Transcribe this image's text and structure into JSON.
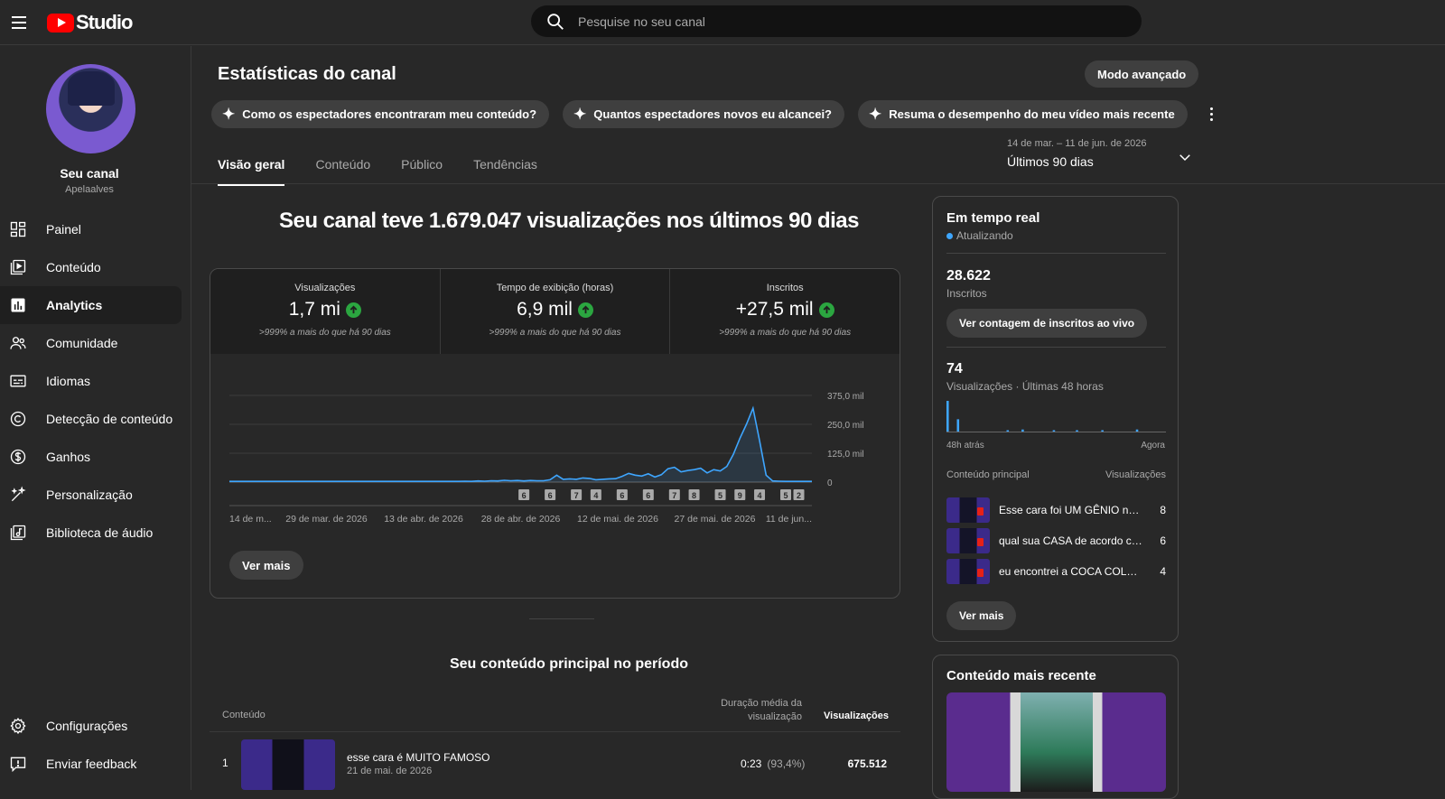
{
  "app": {
    "logo_text": "Studio"
  },
  "search": {
    "placeholder": "Pesquise no seu canal"
  },
  "sidebar": {
    "channel_name": "Seu canal",
    "channel_handle": "Apelaalves",
    "items": [
      {
        "label": "Painel",
        "icon": "dashboard-icon"
      },
      {
        "label": "Conteúdo",
        "icon": "content-icon"
      },
      {
        "label": "Analytics",
        "icon": "analytics-icon",
        "active": true
      },
      {
        "label": "Comunidade",
        "icon": "community-icon"
      },
      {
        "label": "Idiomas",
        "icon": "subtitles-icon"
      },
      {
        "label": "Detecção de conteúdo",
        "icon": "copyright-icon"
      },
      {
        "label": "Ganhos",
        "icon": "dollar-icon"
      },
      {
        "label": "Personalização",
        "icon": "magic-wand-icon"
      },
      {
        "label": "Biblioteca de áudio",
        "icon": "audio-library-icon"
      }
    ],
    "bottom_items": [
      {
        "label": "Configurações",
        "icon": "gear-icon"
      },
      {
        "label": "Enviar feedback",
        "icon": "feedback-icon"
      }
    ]
  },
  "header": {
    "title": "Estatísticas do canal",
    "advanced_mode": "Modo avançado",
    "chips": [
      "Como os espectadores encontraram meu conteúdo?",
      "Quantos espectadores novos eu alcancei?",
      "Resuma o desempenho do meu vídeo mais recente"
    ],
    "tabs": [
      "Visão geral",
      "Conteúdo",
      "Público",
      "Tendências"
    ],
    "date_range": "14 de mar. – 11 de jun. de 2026",
    "date_label": "Últimos 90 dias"
  },
  "overview": {
    "headline": "Seu canal teve 1.679.047 visualizações nos últimos 90 dias",
    "kpis": [
      {
        "label": "Visualizações",
        "value": "1,7 mi",
        "note": ">999% a mais do que há 90 dias"
      },
      {
        "label": "Tempo de exibição (horas)",
        "value": "6,9 mil",
        "note": ">999% a mais do que há 90 dias"
      },
      {
        "label": "Inscritos",
        "value": "+27,5 mil",
        "note": ">999% a mais do que há 90 dias"
      }
    ],
    "see_more": "Ver mais"
  },
  "chart_data": {
    "type": "area",
    "x_tick_labels": [
      "14 de m...",
      "29 de mar. de 2026",
      "13 de abr. de 2026",
      "28 de abr. de 2026",
      "12 de mai. de 2026",
      "27 de mai. de 2026",
      "11 de jun..."
    ],
    "y_tick_labels": [
      "375,0 mil",
      "250,0 mil",
      "125,0 mil",
      "0"
    ],
    "ylim": [
      0,
      375000
    ],
    "grid": true,
    "series": [
      {
        "values": [
          3000,
          3000,
          3000,
          3000,
          3000,
          3000,
          3000,
          3000,
          3000,
          3000,
          3000,
          3000,
          3000,
          3000,
          3000,
          3000,
          3000,
          3000,
          3000,
          3000,
          3000,
          3000,
          3000,
          3000,
          3000,
          3000,
          3000,
          3000,
          3000,
          3000,
          3000,
          3000,
          3000,
          3000,
          3000,
          3000,
          4000,
          3000,
          5000,
          4000,
          6000,
          5000,
          8000,
          6000,
          7000,
          5000,
          7000,
          6000,
          6000,
          10000,
          30000,
          12000,
          14000,
          12000,
          18000,
          16000,
          10000,
          12000,
          14000,
          15000,
          25000,
          38000,
          30000,
          26000,
          36000,
          22000,
          32000,
          58000,
          64000,
          44000,
          50000,
          54000,
          60000,
          40000,
          54000,
          48000,
          68000,
          120000,
          190000,
          250000,
          320000,
          180000,
          30000,
          5000,
          4000,
          3000,
          3000,
          3000,
          3000,
          3000
        ]
      }
    ],
    "upload_markers": [
      {
        "index": 45,
        "count": "6"
      },
      {
        "index": 49,
        "count": "6"
      },
      {
        "index": 53,
        "count": "7"
      },
      {
        "index": 56,
        "count": "4"
      },
      {
        "index": 60,
        "count": "6"
      },
      {
        "index": 64,
        "count": "6"
      },
      {
        "index": 68,
        "count": "7"
      },
      {
        "index": 71,
        "count": "8"
      },
      {
        "index": 75,
        "count": "5"
      },
      {
        "index": 78,
        "count": "9"
      },
      {
        "index": 81,
        "count": "4"
      },
      {
        "index": 85,
        "count": "5"
      },
      {
        "index": 87,
        "count": "2"
      }
    ]
  },
  "top_content": {
    "title": "Seu conteúdo principal no período",
    "col_content": "Conteúdo",
    "col_duration": "Duração média da visualização",
    "col_views": "Visualizações",
    "rows": [
      {
        "rank": "1",
        "title": "esse cara é MUITO FAMOSO",
        "date": "21 de mai. de 2026",
        "duration": "0:23",
        "percent": "(93,4%)",
        "views": "675.512"
      }
    ]
  },
  "realtime": {
    "title": "Em tempo real",
    "status": "Atualizando",
    "subscribers": "28.622",
    "subscribers_label": "Inscritos",
    "live_count_button": "Ver contagem de inscritos ao vivo",
    "views": "74",
    "views_label": "Visualizações · Últimas 48 horas",
    "axis_start": "48h atrás",
    "axis_end": "Agora",
    "bars": [
      30,
      0,
      0,
      0,
      0,
      0,
      0,
      0,
      0,
      12,
      0,
      0,
      0,
      0,
      0,
      0,
      0,
      0,
      0,
      0,
      0,
      0,
      0,
      0,
      0,
      0,
      0,
      0,
      0,
      0,
      0,
      0,
      0,
      0,
      0,
      0,
      0,
      0,
      0,
      0,
      0,
      0,
      0,
      0,
      0,
      0,
      0,
      0,
      0,
      0,
      0,
      0,
      1,
      0,
      0,
      0,
      0,
      0,
      0,
      0,
      0,
      0,
      0,
      0,
      0,
      2,
      0,
      0,
      0,
      0,
      0,
      0,
      0,
      0,
      0,
      0,
      0,
      0,
      0,
      0,
      0,
      0,
      0,
      0,
      0,
      0,
      0,
      0,
      0,
      0,
      0,
      0,
      1,
      0,
      0,
      0,
      0,
      0,
      0,
      0,
      0,
      0,
      0,
      0,
      0,
      0,
      0,
      0,
      0,
      0,
      0,
      0,
      1,
      0,
      0,
      0,
      0,
      0,
      0,
      0,
      0,
      0,
      0,
      0,
      0,
      0,
      0,
      0,
      0,
      0,
      0,
      0,
      0,
      0,
      1,
      0,
      0,
      0,
      0,
      0,
      0,
      0,
      0,
      0,
      0,
      0,
      0,
      0,
      0,
      0,
      0,
      0,
      0,
      0,
      0,
      0,
      0,
      0,
      0,
      0,
      0,
      0,
      0,
      0,
      2,
      0,
      0,
      0,
      0,
      0,
      0,
      0,
      0,
      0,
      0,
      0,
      0,
      0,
      0,
      0,
      0,
      0,
      0,
      0,
      0,
      0,
      0,
      0,
      0,
      0
    ],
    "top_content_label": "Conteúdo principal",
    "top_views_label": "Visualizações",
    "items": [
      {
        "title": "Esse cara foi UM GÊNIO ness...",
        "views": "8"
      },
      {
        "title": "qual sua CASA de acordo co...",
        "views": "6"
      },
      {
        "title": "eu encontrei a COCA COLA Q...",
        "views": "4"
      }
    ],
    "see_more": "Ver mais"
  },
  "recent": {
    "title": "Conteúdo mais recente"
  }
}
